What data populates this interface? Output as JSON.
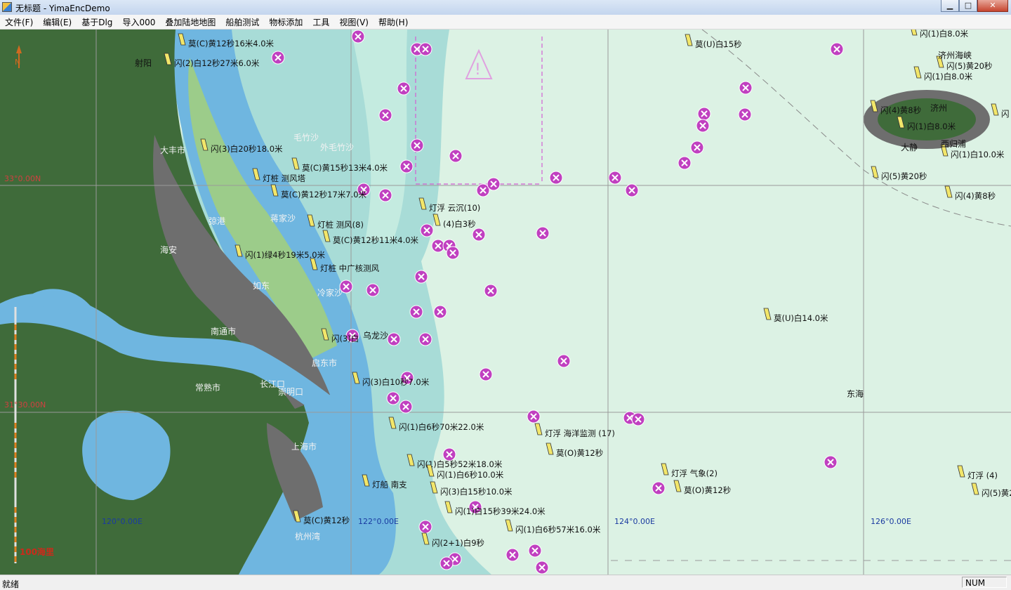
{
  "window": {
    "title": "无标题 - YimaEncDemo",
    "minimize": "▁",
    "maximize": "□",
    "close": "✕"
  },
  "menu": [
    "文件(F)",
    "编辑(E)",
    "基于Dlg",
    "导入000",
    "叠加陆地地图",
    "船舶测试",
    "物标添加",
    "工具",
    "视图(V)",
    "帮助(H)"
  ],
  "status": {
    "text": "就绪",
    "num": "NUM"
  },
  "scale": "100海里",
  "north": "N",
  "coords": [
    {
      "text": "33°0.00N"
    },
    {
      "text": "31°30.00N"
    },
    {
      "text": "120°0.00E"
    },
    {
      "text": "122°0.00E"
    },
    {
      "text": "124°0.00E"
    },
    {
      "text": "126°0.00E"
    }
  ],
  "places": [
    "射阳",
    "大丰市",
    "弶港",
    "海安",
    "如东",
    "南通市",
    "启东市",
    "常熟市",
    "长江口",
    "崇明口",
    "上海市",
    "杭州湾",
    "毛竹沙",
    "外毛竹沙",
    "蒋家沙",
    "冷家沙",
    "乌龙沙",
    "东海",
    "济州海峡",
    "济州",
    "大静",
    "西归浦"
  ],
  "light_labels": [
    "莫(C)黄12秒16米4.0米",
    "闪(2)白12秒27米6.0米",
    "闪(3)白20秒18.0米",
    "莫(C)黄15秒13米4.0米",
    "灯桩 测风塔",
    "莫(C)黄12秒17米7.0米",
    "灯桩 测风(8)",
    "莫(C)黄12秒11米4.0米",
    "闪(1)绿4秒19米5.0米",
    "灯桩 中广核测风",
    "闪(3)白",
    "闪(3)白10秒7.0米",
    "闪(1)白6秒70米22.0米",
    "闪(1)白5秒52米18.0米",
    "闪(1)白6秒10.0米",
    "闪(3)白15秒10.0米",
    "闪(1)白15秒39米24.0米",
    "闪(1)白6秒57米16.0米",
    "闪(2+1)白9秒",
    "莫(C)黄12秒",
    "灯船 南支",
    "灯浮 云沉(10)",
    "(4)白3秒",
    "灯浮 海洋监测 (17)",
    "莫(O)黄12秒",
    "灯浮 气象(2)",
    "莫(O)黄12秒",
    "莫(U)白15秒",
    "莫(U)白14.0米",
    "闪(1)白8.0米",
    "闪(5)黄20秒",
    "闪(1)白8.0米",
    "闪(4)黄8秒",
    "闪(1)白8.0米",
    "闪(1)白10.0米",
    "闪(5)黄20秒",
    "闪(4)黄8秒",
    "灯浮 (4)",
    "闪(5)黄2",
    "闪"
  ],
  "colors": {
    "land": "#3f6b3a",
    "urban": "#6e6e6e",
    "deep_water": "#6fb6e0",
    "shallow": "#a8dcd7",
    "sea": "#dcf2e4",
    "wreck": "#c040c0",
    "intertidal": "#9ccc8a"
  }
}
